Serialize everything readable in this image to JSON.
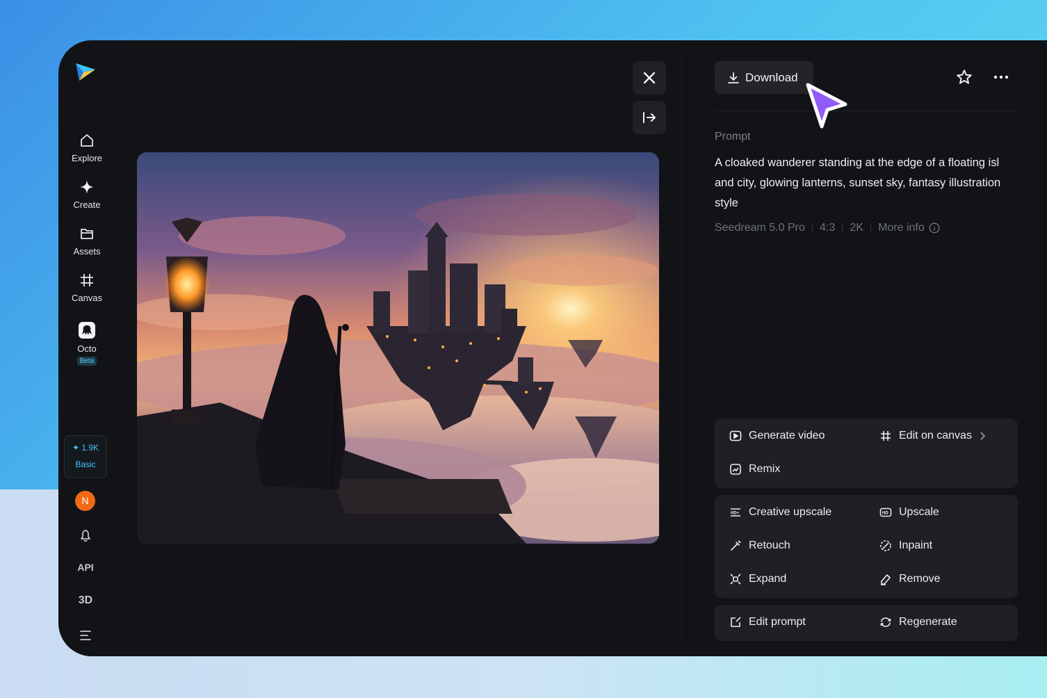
{
  "sidebar": {
    "items": [
      {
        "label": "Explore"
      },
      {
        "label": "Create"
      },
      {
        "label": "Assets"
      },
      {
        "label": "Canvas"
      },
      {
        "label": "Octo",
        "badge": "Beta"
      }
    ],
    "credits": {
      "amount": "1.9K",
      "plan": "Basic"
    },
    "avatar_letter": "N",
    "api_label": "API",
    "three_d_label": "3D"
  },
  "panel": {
    "download_label": "Download",
    "prompt_label": "Prompt",
    "prompt_text": "A cloaked wanderer standing at the edge of a floating isl and city, glowing lanterns, sunset sky, fantasy illustration style",
    "meta": {
      "model": "Seedream 5.0 Pro",
      "ratio": "4:3",
      "resolution": "2K",
      "more_info": "More info"
    },
    "actions_group1": [
      "Generate video",
      "Edit on canvas",
      "Remix"
    ],
    "actions_group2": [
      "Creative upscale",
      "Upscale",
      "Retouch",
      "Inpaint",
      "Expand",
      "Remove"
    ],
    "actions_group3": [
      "Edit prompt",
      "Regenerate"
    ]
  },
  "colors": {
    "accent": "#3fc6ff",
    "cursor": "#8f5cf7",
    "avatar": "#f06a16"
  }
}
